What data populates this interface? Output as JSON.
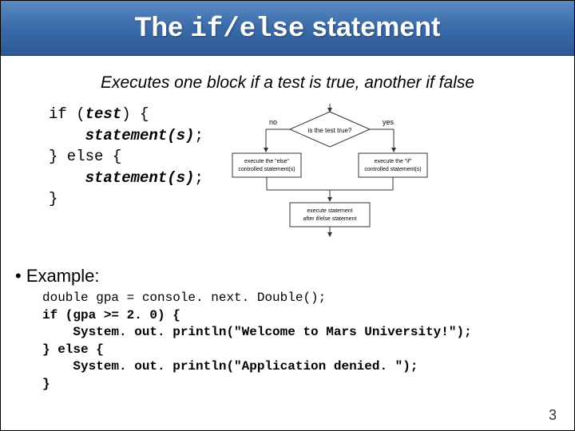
{
  "title": {
    "pre": "The ",
    "code": "if/else",
    "post": " statement"
  },
  "subtitle": "Executes one block if a test is true, another if false",
  "syntax": {
    "l1a": "if (",
    "l1b": "test",
    "l1c": ") {",
    "l2": "statement(s)",
    "l2end": ";",
    "l3": "} else {",
    "l4": "statement(s)",
    "l4end": ";",
    "l5": "}"
  },
  "diagram": {
    "no": "no",
    "yes": "yes",
    "test": "is the test true?",
    "elsebox": "execute the \"else\"\ncontrolled statement(s)",
    "ifbox": "execute the \"if\"\ncontrolled statement(s)",
    "after": "execute statement\nafter if/else statement"
  },
  "example_label": "• Example:",
  "example": {
    "l1": "double gpa = console. next. Double();",
    "l2": "if (gpa >= 2. 0) {",
    "l3": "    System. out. println(\"Welcome to Mars University!\");",
    "l4": "} else {",
    "l5": "    System. out. println(\"Application denied. \");",
    "l6": "}"
  },
  "pagenum": "3"
}
